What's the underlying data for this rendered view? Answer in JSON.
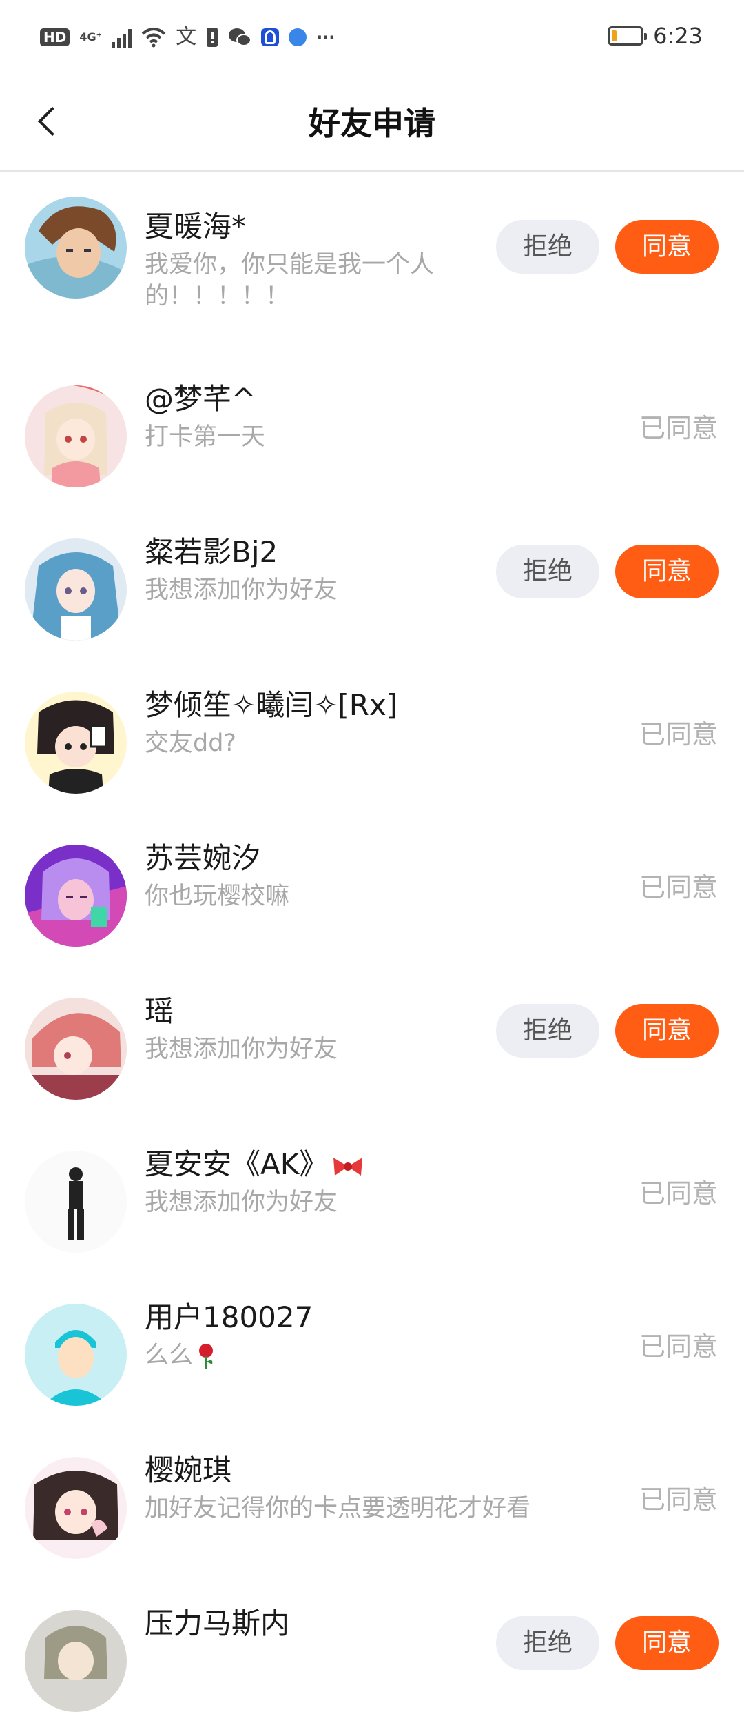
{
  "status_bar": {
    "hd": "HD",
    "net": "4G⁺",
    "time": "6:23",
    "battery_level": 0.18,
    "battery_color": "#f0a21a",
    "more": "···"
  },
  "header": {
    "title": "好友申请"
  },
  "labels": {
    "reject": "拒绝",
    "agree": "同意",
    "agreed": "已同意"
  },
  "accent": "#ff5c14",
  "requests": [
    {
      "name": "夏暖海*",
      "message": "我爱你，你只能是我一个人的！！！！！",
      "status": "pending"
    },
    {
      "name": "@梦芊^",
      "message": "打卡第一天",
      "status": "agreed"
    },
    {
      "name": "粲若影Bj2",
      "message": "我想添加你为好友",
      "status": "pending"
    },
    {
      "name": "梦倾笙✧曦闫✧[Rx]",
      "message": "交友dd?",
      "status": "agreed"
    },
    {
      "name": "苏芸婉汐",
      "message": "你也玩樱校嘛",
      "status": "agreed"
    },
    {
      "name": "瑶",
      "message": "我想添加你为好友",
      "status": "pending"
    },
    {
      "name": "夏安安《AK》",
      "message": "我想添加你为好友",
      "status": "agreed"
    },
    {
      "name": "用户180027",
      "message": "么么",
      "status": "agreed"
    },
    {
      "name": "樱婉琪",
      "message": "加好友记得你的卡点要透明花才好看",
      "status": "agreed"
    },
    {
      "name": "压力马斯内",
      "message": "",
      "status": "pending"
    }
  ]
}
